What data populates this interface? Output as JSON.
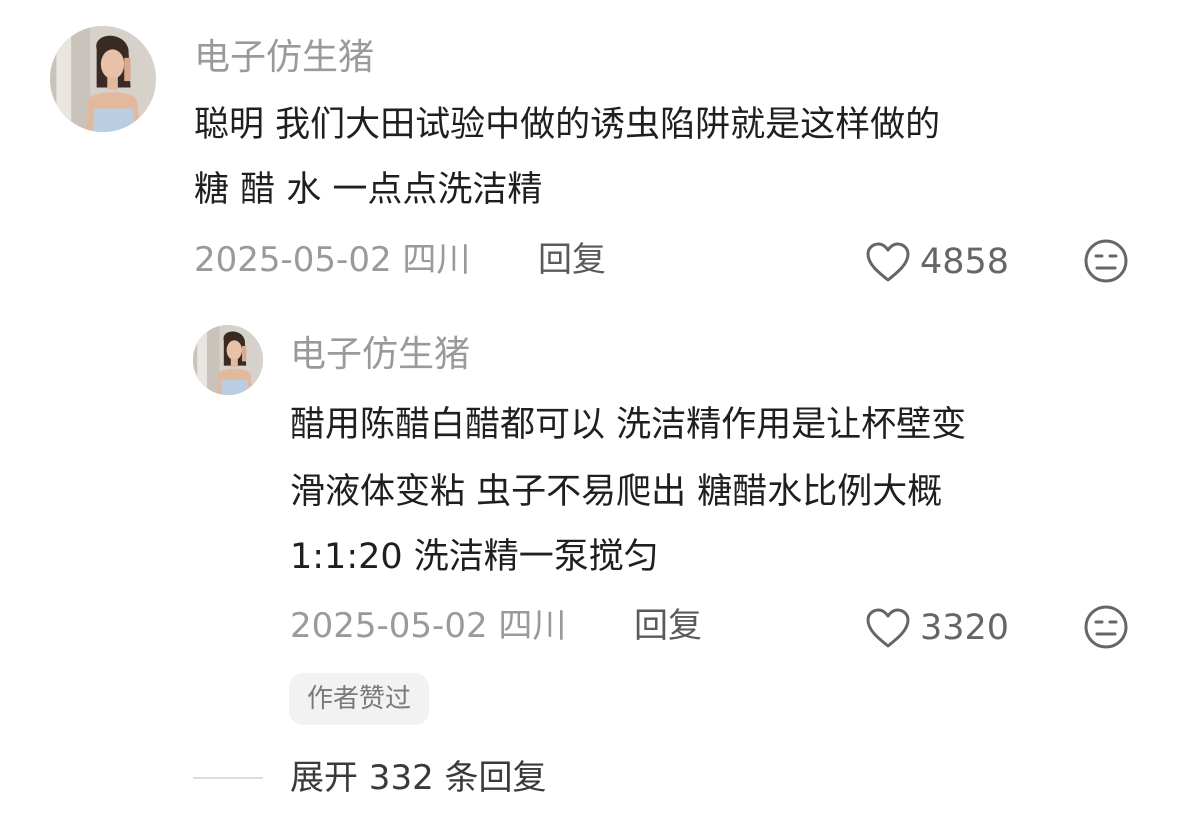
{
  "comment": {
    "username": "电子仿生猪",
    "text_lines": [
      "聪明  我们大田试验中做的诱虫陷阱就是这样做的",
      "糖 醋 水 一点点洗洁精"
    ],
    "date_location": "2025-05-02 四川",
    "reply_label": "回复",
    "like_count": "4858",
    "avatar_icon": "user-avatar",
    "like_icon": "heart-outline-icon",
    "dislike_icon": "meh-face-icon"
  },
  "reply": {
    "username": "电子仿生猪",
    "text_lines": [
      "醋用陈醋白醋都可以  洗洁精作用是让杯壁变",
      "滑液体变粘   虫子不易爬出  糖醋水比例大概",
      "1:1:20  洗洁精一泵搅匀"
    ],
    "date_location": "2025-05-02 四川",
    "reply_label": "回复",
    "like_count": "3320",
    "author_liked_badge": "作者赞过",
    "avatar_icon": "user-avatar",
    "like_icon": "heart-outline-icon",
    "dislike_icon": "meh-face-icon"
  },
  "expand": {
    "label": "展开 332 条回复"
  },
  "colors": {
    "username": "#9a9a9a",
    "text": "#1f1f1f",
    "meta": "#9a9a9a",
    "badge_bg": "#f2f2f2"
  }
}
